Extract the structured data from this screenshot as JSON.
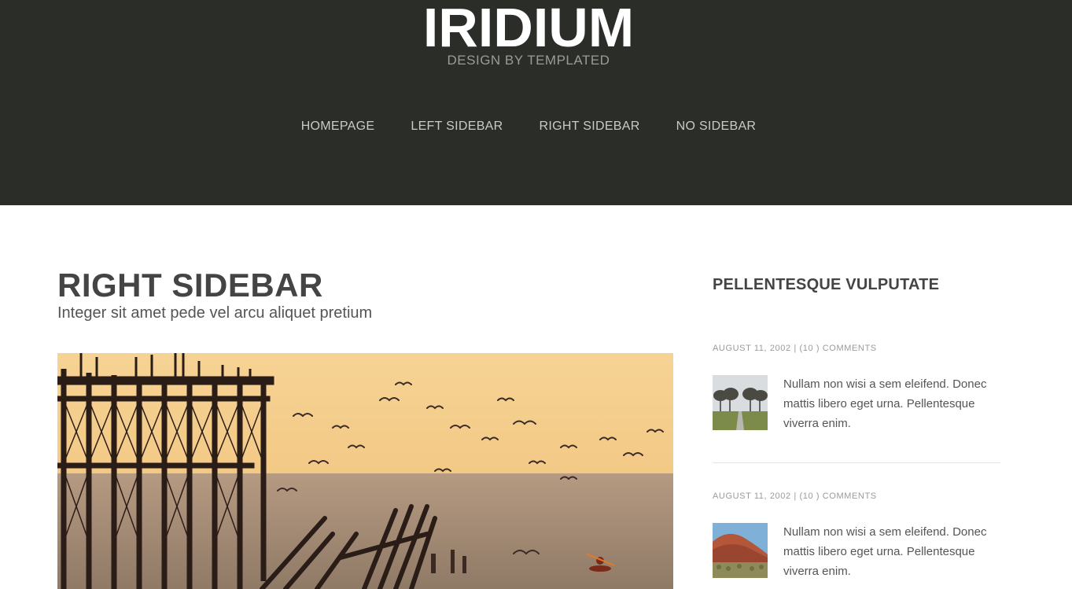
{
  "header": {
    "logo_title": "IRIDIUM",
    "logo_subtitle": "DESIGN BY TEMPLATED",
    "background": "#2a2d28"
  },
  "nav": {
    "items": [
      {
        "label": "HOMEPAGE"
      },
      {
        "label": "LEFT SIDEBAR"
      },
      {
        "label": "RIGHT SIDEBAR"
      },
      {
        "label": "NO SIDEBAR"
      }
    ]
  },
  "main": {
    "title": "RIGHT SIDEBAR",
    "subtitle": "Integer sit amet pede vel arcu aliquet pretium"
  },
  "sidebar": {
    "title": "PELLENTESQUE VULPUTATE",
    "posts": [
      {
        "date": "AUGUST 11, 2002",
        "separator": "|",
        "comments": "(10 ) COMMENTS",
        "text": "Nullam non wisi a sem eleifend. Donec mattis libero eget urna. Pellentesque viverra enim."
      },
      {
        "date": "AUGUST 11, 2002",
        "separator": "|",
        "comments": "(10 ) COMMENTS",
        "text": "Nullam non wisi a sem eleifend. Donec mattis libero eget urna. Pellentesque viverra enim."
      }
    ]
  }
}
